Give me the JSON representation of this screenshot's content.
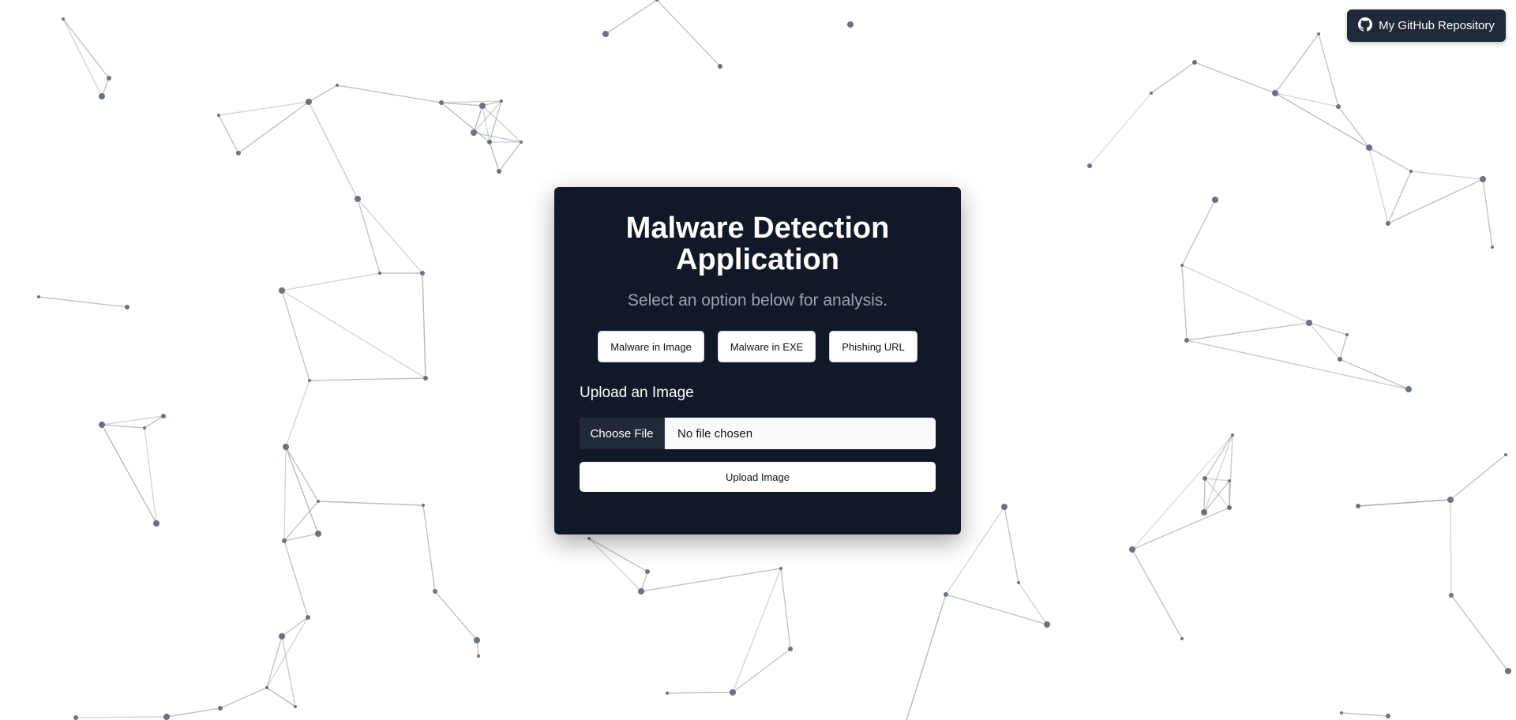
{
  "header": {
    "github_label": "My GitHub Repository",
    "github_icon": "github-icon"
  },
  "card": {
    "title_line1": "Malware Detection",
    "title_line2": "Application",
    "subtitle": "Select an option below for analysis.",
    "options": [
      {
        "label": "Malware in Image"
      },
      {
        "label": "Malware in EXE"
      },
      {
        "label": "Phishing URL"
      }
    ],
    "section_label": "Upload an Image",
    "file_input": {
      "button_label": "Choose File",
      "status": "No file chosen"
    },
    "upload_label": "Upload Image"
  },
  "colors": {
    "card_bg": "#111827",
    "page_bg": "#ffffff",
    "github_bg": "#1f2937",
    "subtitle": "#9ca3af"
  }
}
